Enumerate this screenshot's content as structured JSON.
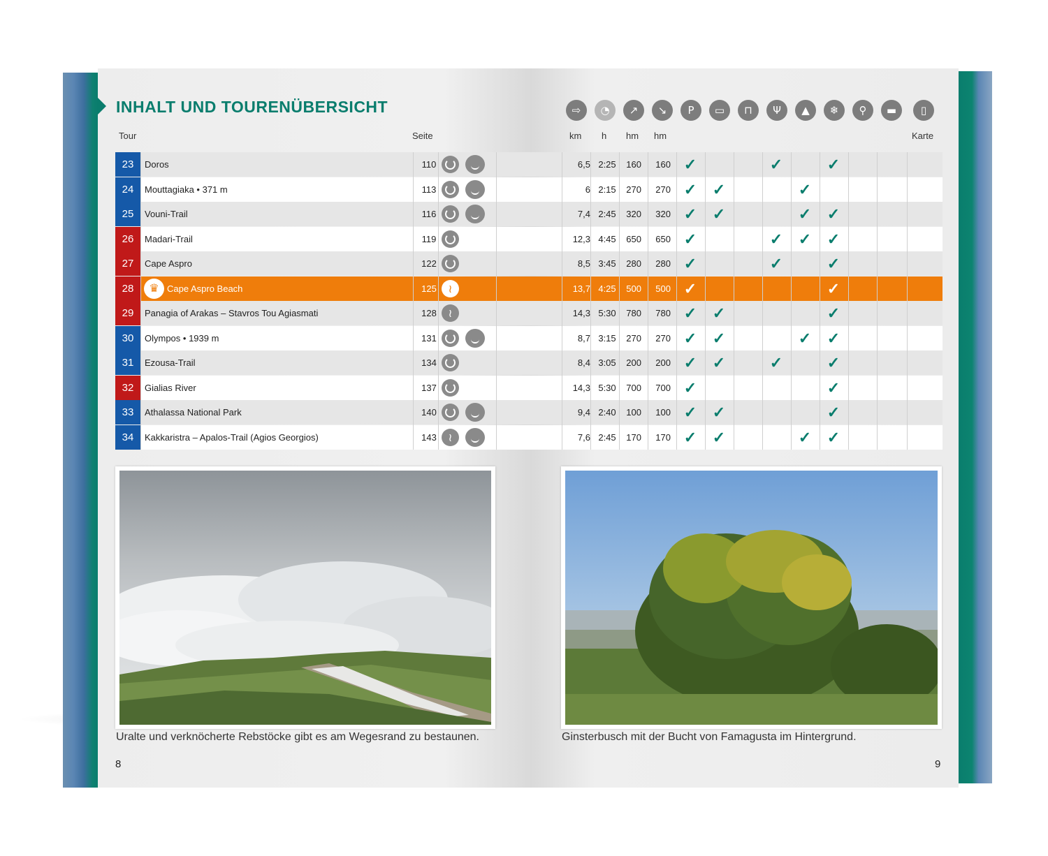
{
  "title": "INHALT UND TOURENÜBERSICHT",
  "headers": {
    "tour": "Tour",
    "seite": "Seite",
    "km": "km",
    "h": "h",
    "hm_up": "hm",
    "hm_down": "hm",
    "karte": "Karte"
  },
  "top_icons": [
    "signpost-icon",
    "clock-icon",
    "ascent-icon",
    "descent-icon",
    "parking-icon",
    "bus-icon",
    "cable-car-icon",
    "restaurant-icon",
    "summit-icon",
    "winter-icon",
    "bike-icon",
    "lodging-icon",
    "map-icon"
  ],
  "top_icon_glyphs": [
    "⇨",
    "◔",
    "↗",
    "↘",
    "P",
    "▭",
    "⊓",
    "Ψ",
    "▲",
    "❄",
    "⚲",
    "▬",
    "▯"
  ],
  "check_glyph": "✓",
  "rows": [
    {
      "no": "23",
      "name": "Doros",
      "page": "110",
      "km": "6,5",
      "h": "2:25",
      "up": "160",
      "down": "160",
      "color": "blue",
      "icons": [
        "circ",
        "bear"
      ],
      "checks": [
        0,
        3,
        5
      ]
    },
    {
      "no": "24",
      "name": "Mouttagiaka • 371 m",
      "page": "113",
      "km": "6",
      "h": "2:15",
      "up": "270",
      "down": "270",
      "color": "blue",
      "icons": [
        "circ",
        "bear"
      ],
      "checks": [
        0,
        1,
        4
      ]
    },
    {
      "no": "25",
      "name": "Vouni-Trail",
      "page": "116",
      "km": "7,4",
      "h": "2:45",
      "up": "320",
      "down": "320",
      "color": "blue",
      "icons": [
        "circ",
        "bear"
      ],
      "checks": [
        0,
        1,
        4,
        5
      ]
    },
    {
      "no": "26",
      "name": "Madari-Trail",
      "page": "119",
      "km": "12,3",
      "h": "4:45",
      "up": "650",
      "down": "650",
      "color": "red",
      "icons": [
        "circ"
      ],
      "checks": [
        0,
        3,
        4,
        5
      ]
    },
    {
      "no": "27",
      "name": "Cape Aspro",
      "page": "122",
      "km": "8,5",
      "h": "3:45",
      "up": "280",
      "down": "280",
      "color": "red",
      "icons": [
        "circ"
      ],
      "checks": [
        0,
        3,
        5
      ]
    },
    {
      "no": "28",
      "name": "Cape Aspro Beach",
      "page": "125",
      "km": "13,7",
      "h": "4:25",
      "up": "500",
      "down": "500",
      "color": "red",
      "icons": [
        "zig"
      ],
      "checks": [
        0,
        5
      ],
      "highlight": true
    },
    {
      "no": "29",
      "name": "Panagia of Arakas – Stavros Tou Agiasmati",
      "page": "128",
      "km": "14,3",
      "h": "5:30",
      "up": "780",
      "down": "780",
      "color": "red",
      "icons": [
        "zig"
      ],
      "checks": [
        0,
        1,
        5
      ]
    },
    {
      "no": "30",
      "name": "Olympos • 1939 m",
      "page": "131",
      "km": "8,7",
      "h": "3:15",
      "up": "270",
      "down": "270",
      "color": "blue",
      "icons": [
        "circ",
        "bear"
      ],
      "checks": [
        0,
        1,
        4,
        5
      ]
    },
    {
      "no": "31",
      "name": "Ezousa-Trail",
      "page": "134",
      "km": "8,4",
      "h": "3:05",
      "up": "200",
      "down": "200",
      "color": "blue",
      "icons": [
        "circ"
      ],
      "checks": [
        0,
        1,
        3,
        5
      ]
    },
    {
      "no": "32",
      "name": "Gialias River",
      "page": "137",
      "km": "14,3",
      "h": "5:30",
      "up": "700",
      "down": "700",
      "color": "red",
      "icons": [
        "circ"
      ],
      "checks": [
        0,
        5
      ]
    },
    {
      "no": "33",
      "name": "Athalassa National Park",
      "page": "140",
      "km": "9,4",
      "h": "2:40",
      "up": "100",
      "down": "100",
      "color": "blue",
      "icons": [
        "circ",
        "bear"
      ],
      "checks": [
        0,
        1,
        5
      ]
    },
    {
      "no": "34",
      "name": "Kakkaristra – Apalos-Trail (Agios Georgios)",
      "page": "143",
      "km": "7,6",
      "h": "2:45",
      "up": "170",
      "down": "170",
      "color": "blue",
      "icons": [
        "zig",
        "bear"
      ],
      "checks": [
        0,
        1,
        4,
        5
      ]
    }
  ],
  "captions": {
    "left": "Uralte und verknöcherte Rebstöcke gibt es am Wegesrand zu bestaunen.",
    "right": "Ginsterbusch mit der Bucht von Famagusta im Hintergrund."
  },
  "page_numbers": {
    "left": "8",
    "right": "9"
  },
  "colors": {
    "accent": "#0a7d6d",
    "blue": "#1559a8",
    "red": "#c01919",
    "highlight": "#ef7d0b"
  }
}
